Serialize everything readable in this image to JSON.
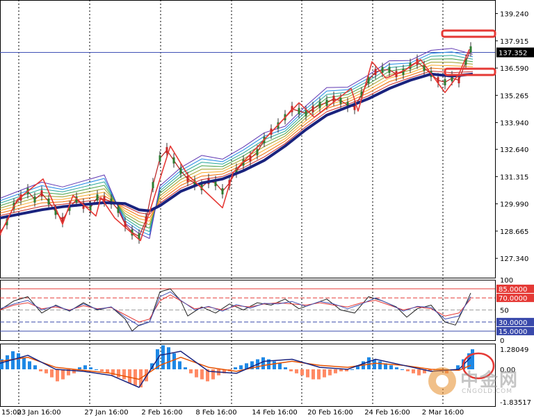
{
  "chart_data": [
    {
      "type": "line",
      "panel": "price",
      "title": "",
      "ylim": [
        126.4,
        139.9
      ],
      "y_ticks": [
        "139.240",
        "137.915",
        "136.590",
        "135.265",
        "133.940",
        "132.640",
        "131.315",
        "129.990",
        "128.665",
        "127.340"
      ],
      "current_price": "137.352",
      "x_ticks": [
        "15:00",
        "23 Jan 16:00",
        "27 Jan 16:00",
        "2 Feb 16:00",
        "8 Feb 16:00",
        "14 Feb 16:00",
        "20 Feb 16:00",
        "24 Feb 16:00",
        "2 Mar 16:00"
      ],
      "series": [
        {
          "role": "moving-average",
          "color": "#1a237e",
          "x": [
            0,
            30,
            60,
            90,
            120,
            150,
            180,
            200,
            215,
            230,
            260,
            290,
            320,
            350,
            380,
            410,
            440,
            470,
            500,
            530,
            560,
            590,
            620,
            650,
            680
          ],
          "values": [
            129.3,
            129.5,
            129.7,
            129.85,
            129.95,
            130.05,
            130.0,
            129.7,
            129.65,
            129.9,
            130.6,
            131.0,
            131.2,
            131.6,
            132.1,
            132.8,
            133.6,
            134.3,
            134.7,
            135.1,
            135.6,
            136.0,
            136.3,
            136.2,
            136.3
          ]
        },
        {
          "role": "zigzag",
          "color": "#e53935",
          "x": [
            0,
            25,
            62,
            90,
            105,
            138,
            145,
            165,
            202,
            245,
            270,
            298,
            320,
            335,
            430,
            452,
            505,
            515,
            535,
            555,
            583,
            605,
            640,
            660,
            675
          ],
          "values": [
            128.5,
            130.2,
            131.2,
            129.0,
            130.4,
            129.4,
            130.3,
            129.3,
            128.2,
            132.8,
            131.4,
            130.5,
            129.8,
            131.5,
            134.9,
            134.2,
            135.6,
            134.5,
            136.9,
            136.1,
            136.5,
            137.0,
            135.4,
            136.3,
            137.5
          ]
        },
        {
          "role": "price",
          "color": "#b71c1c",
          "x": [
            0,
            10,
            20,
            30,
            40,
            50,
            60,
            70,
            80,
            90,
            100,
            110,
            120,
            130,
            140,
            150,
            160,
            170,
            180,
            190,
            200,
            210,
            220,
            230,
            240,
            250,
            260,
            270,
            280,
            290,
            300,
            310,
            320,
            330,
            340,
            350,
            360,
            370,
            380,
            390,
            400,
            410,
            420,
            430,
            440,
            450,
            460,
            470,
            480,
            490,
            500,
            510,
            520,
            530,
            540,
            550,
            560,
            570,
            580,
            590,
            600,
            610,
            620,
            630,
            640,
            650,
            660,
            670,
            677
          ],
          "values": [
            128.6,
            129.1,
            129.9,
            130.3,
            130.6,
            130.2,
            130.5,
            130.1,
            129.6,
            129.2,
            129.8,
            130.2,
            129.9,
            129.8,
            130.3,
            130.2,
            130.1,
            129.7,
            129.0,
            128.6,
            128.4,
            129.2,
            130.9,
            132.2,
            132.6,
            132.1,
            131.6,
            131.2,
            131.0,
            130.8,
            131.1,
            131.0,
            130.6,
            131.0,
            131.6,
            132.0,
            132.2,
            132.5,
            133.1,
            133.5,
            133.8,
            134.2,
            134.6,
            134.5,
            134.4,
            134.6,
            134.8,
            134.9,
            135.1,
            135.0,
            134.8,
            134.7,
            135.3,
            136.0,
            136.4,
            136.5,
            136.5,
            136.3,
            136.4,
            136.7,
            136.9,
            136.6,
            136.3,
            136.0,
            135.9,
            136.1,
            136.0,
            136.9,
            137.5
          ]
        }
      ],
      "levels": [
        {
          "value": 137.352,
          "color": "#3f51b5"
        }
      ]
    },
    {
      "type": "line",
      "panel": "oscillator",
      "ylim": [
        0,
        100
      ],
      "y_ticks": [
        "100",
        "85.0000",
        "70.0000",
        "50",
        "30.0000",
        "15.0000",
        "0"
      ],
      "levels": [
        {
          "value": 85,
          "color": "#e53935",
          "label": "85.0000"
        },
        {
          "value": 70,
          "color": "#e53935",
          "label": "70.0000"
        },
        {
          "value": 50,
          "color": "#9e9e9e",
          "label": "50"
        },
        {
          "value": 30,
          "color": "#3949ab",
          "label": "30.0000"
        },
        {
          "value": 15,
          "color": "#3949ab",
          "label": "15.0000"
        }
      ],
      "series": [
        {
          "color": "#212121",
          "x": [
            0,
            20,
            40,
            60,
            80,
            100,
            120,
            140,
            160,
            180,
            190,
            200,
            215,
            230,
            245,
            260,
            270,
            290,
            310,
            330,
            350,
            370,
            390,
            410,
            430,
            450,
            470,
            490,
            510,
            530,
            550,
            570,
            585,
            600,
            620,
            640,
            655,
            670,
            677
          ],
          "values": [
            50,
            65,
            72,
            45,
            58,
            48,
            62,
            50,
            55,
            35,
            15,
            25,
            30,
            80,
            85,
            65,
            40,
            55,
            45,
            60,
            50,
            62,
            58,
            68,
            52,
            60,
            68,
            50,
            45,
            72,
            65,
            55,
            38,
            52,
            58,
            30,
            25,
            60,
            78
          ]
        },
        {
          "color": "#e53935",
          "x": [
            0,
            20,
            40,
            60,
            80,
            100,
            120,
            140,
            160,
            180,
            200,
            215,
            230,
            245,
            260,
            280,
            300,
            320,
            340,
            360,
            380,
            400,
            420,
            440,
            460,
            480,
            500,
            520,
            540,
            560,
            580,
            600,
            620,
            640,
            660,
            677
          ],
          "values": [
            50,
            58,
            62,
            52,
            55,
            50,
            57,
            52,
            54,
            42,
            30,
            35,
            65,
            75,
            65,
            52,
            55,
            50,
            57,
            55,
            60,
            62,
            60,
            58,
            62,
            58,
            55,
            62,
            66,
            58,
            50,
            55,
            52,
            40,
            45,
            68
          ]
        },
        {
          "color": "#3f51b5",
          "x": [
            0,
            20,
            40,
            60,
            80,
            100,
            120,
            140,
            160,
            180,
            200,
            215,
            230,
            245,
            260,
            280,
            300,
            320,
            340,
            360,
            380,
            400,
            420,
            440,
            460,
            480,
            500,
            520,
            540,
            560,
            580,
            600,
            620,
            640,
            660,
            677
          ],
          "values": [
            52,
            60,
            66,
            50,
            57,
            49,
            60,
            51,
            55,
            38,
            24,
            30,
            72,
            80,
            66,
            50,
            56,
            48,
            59,
            53,
            61,
            60,
            64,
            56,
            64,
            60,
            52,
            60,
            70,
            60,
            48,
            56,
            54,
            35,
            40,
            72
          ]
        }
      ]
    },
    {
      "type": "bar",
      "panel": "macd",
      "ylim": [
        -1.83517,
        1.28049
      ],
      "y_ticks": [
        "1.28049",
        "0.00",
        "-1.83517"
      ],
      "bar_colors": {
        "positive": "#1e88e5",
        "negative": "#ff8a65"
      },
      "x": [
        0,
        8,
        16,
        24,
        32,
        40,
        48,
        56,
        64,
        72,
        80,
        88,
        96,
        104,
        112,
        120,
        128,
        136,
        144,
        152,
        160,
        168,
        176,
        184,
        192,
        200,
        208,
        216,
        224,
        232,
        240,
        248,
        256,
        264,
        272,
        280,
        288,
        296,
        304,
        312,
        320,
        328,
        336,
        344,
        352,
        360,
        368,
        376,
        384,
        392,
        400,
        408,
        416,
        424,
        432,
        440,
        448,
        456,
        464,
        472,
        480,
        488,
        496,
        504,
        512,
        520,
        528,
        536,
        544,
        552,
        560,
        568,
        576,
        584,
        592,
        600,
        608,
        616,
        624,
        632,
        640,
        648,
        656,
        664,
        672,
        677
      ],
      "values": [
        0.5,
        0.7,
        0.9,
        0.8,
        0.6,
        0.4,
        0.2,
        -0.1,
        -0.2,
        -0.4,
        -0.6,
        -0.5,
        -0.3,
        -0.2,
        0.1,
        0.2,
        0.1,
        0.0,
        -0.1,
        -0.2,
        -0.3,
        -0.4,
        -0.5,
        -0.7,
        -0.8,
        -0.9,
        -0.6,
        0.3,
        1.0,
        1.2,
        1.1,
        0.8,
        0.4,
        0.1,
        -0.2,
        -0.4,
        -0.5,
        -0.6,
        -0.5,
        -0.3,
        -0.2,
        -0.1,
        0.1,
        0.2,
        0.3,
        0.4,
        0.5,
        0.6,
        0.5,
        0.4,
        0.3,
        0.1,
        -0.1,
        -0.2,
        -0.3,
        -0.4,
        -0.5,
        -0.5,
        -0.4,
        -0.3,
        -0.2,
        -0.1,
        -0.1,
        0.0,
        0.2,
        0.4,
        0.6,
        0.5,
        0.4,
        0.3,
        0.2,
        0.1,
        0.0,
        -0.1,
        -0.2,
        -0.3,
        -0.2,
        -0.1,
        0.0,
        -0.1,
        -0.2,
        0.0,
        0.2,
        0.5,
        0.8,
        1.0
      ],
      "signal": {
        "color": "#e65100",
        "x": [
          0,
          40,
          80,
          120,
          160,
          200,
          230,
          260,
          300,
          340,
          380,
          420,
          460,
          500,
          540,
          580,
          620,
          660,
          677
        ],
        "values": [
          0.4,
          0.6,
          0.1,
          -0.05,
          -0.2,
          -0.5,
          0.2,
          0.6,
          0.1,
          -0.1,
          0.2,
          0.4,
          0.2,
          0.1,
          0.3,
          0.2,
          0.0,
          -0.05,
          0.2
        ]
      },
      "macd_line": {
        "color": "#1a237e",
        "x": [
          0,
          40,
          80,
          120,
          160,
          200,
          230,
          260,
          300,
          340,
          380,
          420,
          460,
          500,
          540,
          580,
          620,
          660,
          677
        ],
        "values": [
          0.3,
          0.7,
          0.0,
          -0.1,
          -0.3,
          -0.9,
          0.7,
          0.9,
          -0.1,
          -0.2,
          0.4,
          0.5,
          0.1,
          0.0,
          0.5,
          0.2,
          -0.1,
          0.0,
          0.6
        ]
      }
    }
  ],
  "watermark": {
    "brand": "中金网",
    "sub": "CNGOLD.COM",
    "tag": "中 金 财 经 新 媒 体"
  },
  "colors": {
    "grid": "#000000",
    "highlight": "#e53935"
  }
}
